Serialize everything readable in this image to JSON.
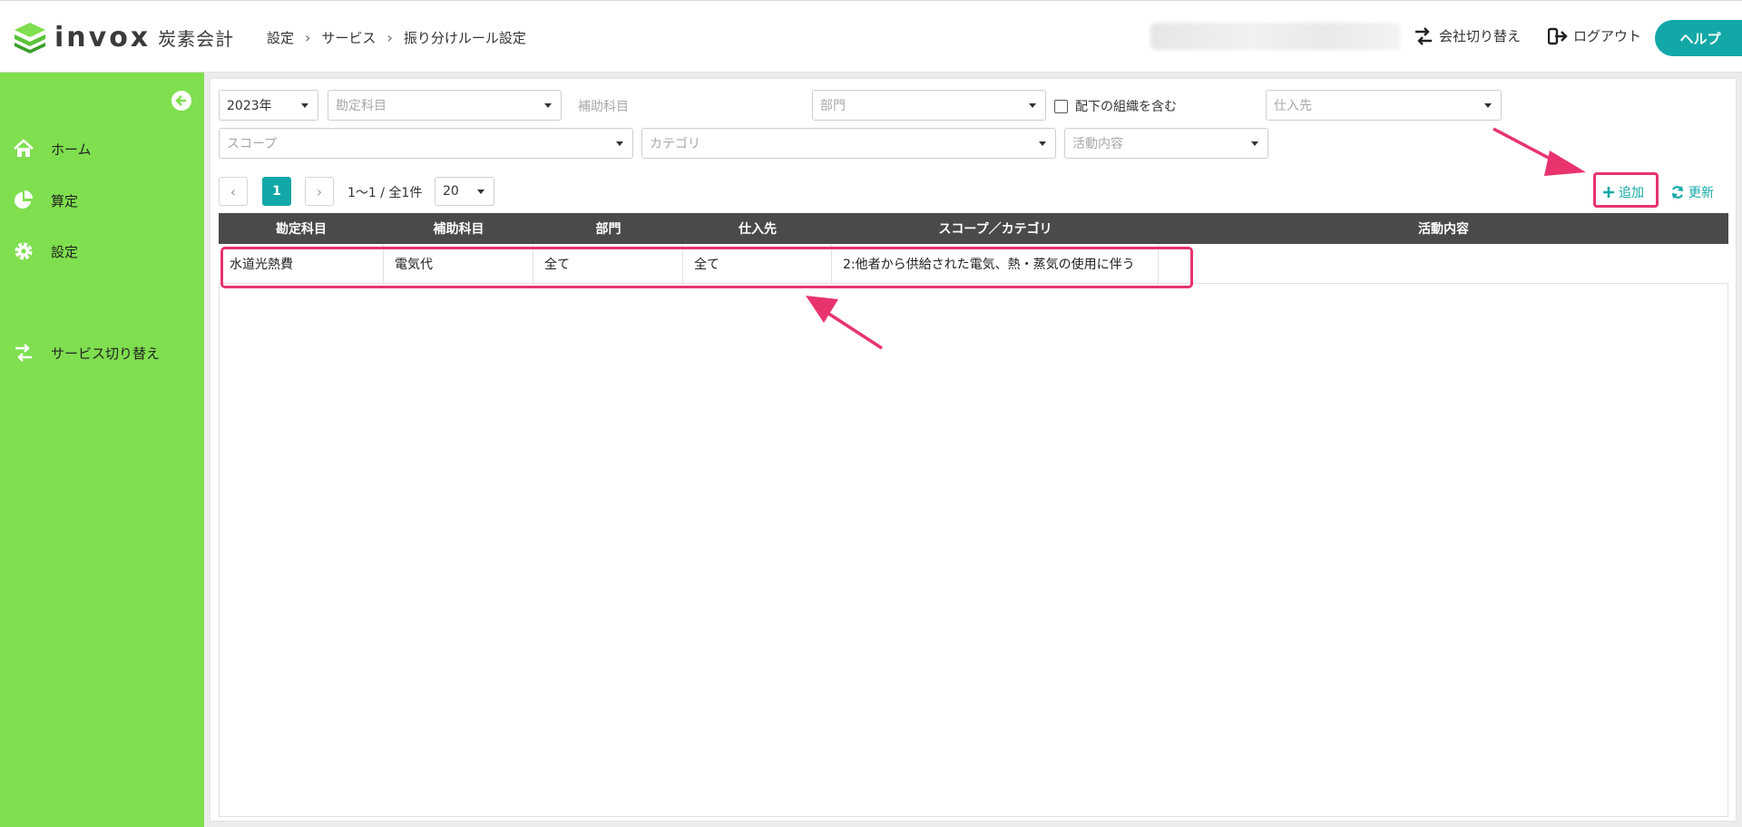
{
  "header": {
    "logo_text": "invox",
    "logo_sub": "炭素会計",
    "breadcrumb": [
      "設定",
      "サービス",
      "振り分けルール設定"
    ],
    "company_switch": "会社切り替え",
    "logout": "ログアウト",
    "help": "ヘルプ"
  },
  "sidebar": {
    "items": [
      {
        "label": "ホーム",
        "icon": "home-icon"
      },
      {
        "label": "算定",
        "icon": "pie-chart-icon"
      },
      {
        "label": "設定",
        "icon": "gear-icon"
      },
      {
        "label": "サービス切り替え",
        "icon": "switch-icon"
      }
    ]
  },
  "filters": {
    "year": "2023年",
    "account_placeholder": "勘定科目",
    "sub_account_label": "補助科目",
    "department_placeholder": "部門",
    "include_sub_orgs": "配下の組織を含む",
    "supplier_placeholder": "仕入先",
    "scope_placeholder": "スコープ",
    "category_placeholder": "カテゴリ",
    "activity_placeholder": "活動内容"
  },
  "pager": {
    "current_page": "1",
    "info": "1〜1 / 全1件",
    "page_size": "20"
  },
  "actions": {
    "add": "追加",
    "refresh": "更新"
  },
  "table": {
    "headers": [
      "勘定科目",
      "補助科目",
      "部門",
      "仕入先",
      "スコープ／カテゴリ",
      "活動内容"
    ],
    "rows": [
      [
        "水道光熱費",
        "電気代",
        "全て",
        "全て",
        "2:他者から供給された電気、熱・蒸気の使用に伴う",
        ""
      ]
    ]
  },
  "colors": {
    "accent": "#13a8a8",
    "sidebar": "#7fdf4f",
    "annotation": "#e8336d"
  }
}
